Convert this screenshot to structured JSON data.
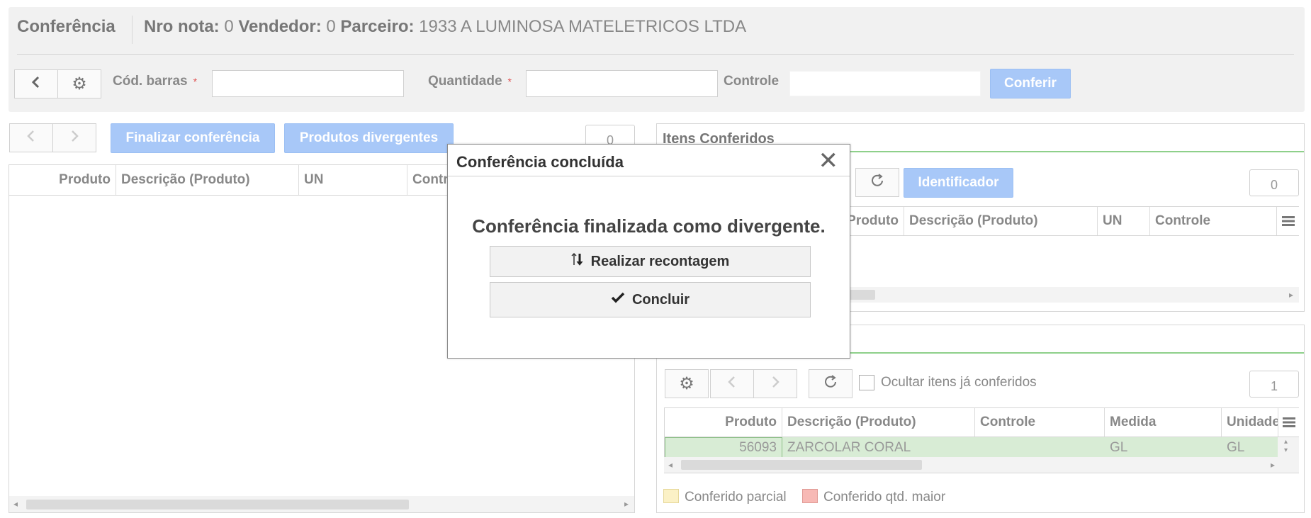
{
  "header": {
    "title": "Conferência",
    "nro_label": "Nro nota:",
    "nro_value": "0",
    "vendedor_label": "Vendedor:",
    "vendedor_value": "0",
    "parceiro_label": "Parceiro:",
    "parceiro_value": "1933 A LUMINOSA MATELETRICOS LTDA"
  },
  "toolbar": {
    "cod_barras_label": "Cód. barras",
    "quantidade_label": "Quantidade",
    "controle_label": "Controle",
    "required_mark": "*",
    "cod_barras_value": "",
    "quantidade_value": "",
    "controle_value": "",
    "conferir_label": "Conferir"
  },
  "left_panel": {
    "finalizar_label": "Finalizar conferência",
    "divergentes_label": "Produtos divergentes",
    "counter": "0",
    "columns": [
      "Produto",
      "Descrição (Produto)",
      "UN",
      "Contr"
    ]
  },
  "itens_conferidos": {
    "title": "Itens Conferidos",
    "identificador_label": "Identificador",
    "counter": "0",
    "columns": [
      "Produto",
      "Descrição (Produto)",
      "UN",
      "Controle"
    ]
  },
  "lower_right": {
    "ocultar_label": "Ocultar itens já conferidos",
    "counter": "1",
    "columns": [
      "Produto",
      "Descrição (Produto)",
      "Controle",
      "Medida",
      "Unidade"
    ],
    "rows": [
      {
        "produto": "56093",
        "descricao": "ZARCOLAR CORAL",
        "controle": "",
        "medida": "GL",
        "unidade": "GL"
      }
    ]
  },
  "legend": {
    "parcial_label": "Conferido parcial",
    "maior_label": "Conferido qtd. maior",
    "parcial_color": "#fbf1c6",
    "maior_color": "#f7b9b5"
  },
  "modal": {
    "title": "Conferência concluída",
    "close_glyph": "✕",
    "message": "Conferência finalizada como divergente.",
    "recontagem_label": "Realizar recontagem",
    "concluir_label": "Concluir"
  },
  "colors": {
    "accent_blue": "#a8c8f8",
    "row_green": "#d8ecd5",
    "section_green": "#8ed08a"
  }
}
